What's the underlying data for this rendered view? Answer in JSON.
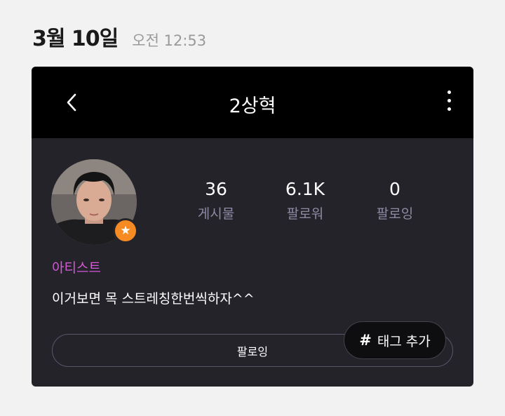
{
  "message": {
    "date": "3월 10일",
    "time": "오전 12:53"
  },
  "profile": {
    "header_title": "2상혁",
    "stats": [
      {
        "value": "36",
        "label": "게시물"
      },
      {
        "value": "6.1K",
        "label": "팔로워"
      },
      {
        "value": "0",
        "label": "팔로잉"
      }
    ],
    "role_label": "아티스트",
    "bio": "이거보면 목 스트레칭한번씩하자^^",
    "follow_button_label": "팔로잉",
    "tag_button": {
      "symbol": "#",
      "label": "태그 추가"
    }
  },
  "icons": {
    "back": "chevron-left-icon",
    "more": "more-vertical-icon",
    "badge": "star-icon",
    "tag": "hash-icon"
  },
  "colors": {
    "card_bg": "#24232a",
    "header_bg": "#000000",
    "role_accent": "#d45ad6",
    "badge": "#f68b23",
    "stat_label": "#8d8aa3"
  }
}
